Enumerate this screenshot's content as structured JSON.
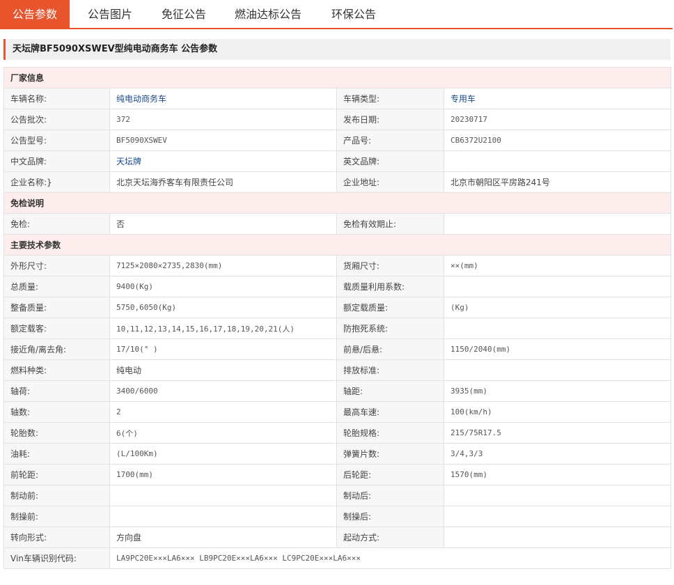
{
  "tabs": [
    "公告参数",
    "公告图片",
    "免征公告",
    "燃油达标公告",
    "环保公告"
  ],
  "title": "天坛牌BF5090XSWEV型纯电动商务车 公告参数",
  "sections": {
    "manufacturer": "厂家信息",
    "exemption": "免检说明",
    "tech": "主要技术参数"
  },
  "rows": {
    "r1": {
      "l1": "车辆名称:",
      "v1": "纯电动商务车",
      "l2": "车辆类型:",
      "v2": "专用车"
    },
    "r2": {
      "l1": "公告批次:",
      "v1": "372",
      "l2": "发布日期:",
      "v2": "20230717"
    },
    "r3": {
      "l1": "公告型号:",
      "v1": "BF5090XSWEV",
      "l2": "产品号:",
      "v2": "CB6372U2100"
    },
    "r4": {
      "l1": "中文品牌:",
      "v1": "天坛牌",
      "l2": "英文品牌:",
      "v2": ""
    },
    "r5": {
      "l1": "企业名称:}",
      "v1": "北京天坛海乔客车有限责任公司",
      "l2": "企业地址:",
      "v2": "北京市朝阳区平房路241号"
    },
    "r6": {
      "l1": "免检:",
      "v1": "否",
      "l2": "免检有效期止:",
      "v2": ""
    },
    "r7": {
      "l1": "外形尺寸:",
      "v1": "7125×2080×2735,2830(mm)",
      "l2": "货厢尺寸:",
      "v2": "××(mm)"
    },
    "r8": {
      "l1": "总质量:",
      "v1": "9400(Kg)",
      "l2": "载质量利用系数:",
      "v2": ""
    },
    "r9": {
      "l1": "整备质量:",
      "v1": "5750,6050(Kg)",
      "l2": "额定载质量:",
      "v2": "(Kg)"
    },
    "r10": {
      "l1": "额定载客:",
      "v1": "10,11,12,13,14,15,16,17,18,19,20,21(人)",
      "l2": "防抱死系统:",
      "v2": ""
    },
    "r11": {
      "l1": "接近角/离去角:",
      "v1": "17/10(° )",
      "l2": "前悬/后悬:",
      "v2": "1150/2040(mm)"
    },
    "r12": {
      "l1": "燃料种类:",
      "v1": "纯电动",
      "l2": "排放标准:",
      "v2": ""
    },
    "r13": {
      "l1": "轴荷:",
      "v1": "3400/6000",
      "l2": "轴距:",
      "v2": "3935(mm)"
    },
    "r14": {
      "l1": "轴数:",
      "v1": "2",
      "l2": "最高车速:",
      "v2": "100(km/h)"
    },
    "r15": {
      "l1": "轮胎数:",
      "v1": "6(个)",
      "l2": "轮胎规格:",
      "v2": "215/75R17.5"
    },
    "r16": {
      "l1": "油耗:",
      "v1": "(L/100Km)",
      "l2": "弹簧片数:",
      "v2": "3/4,3/3"
    },
    "r17": {
      "l1": "前轮距:",
      "v1": "1700(mm)",
      "l2": "后轮距:",
      "v2": "1570(mm)"
    },
    "r18": {
      "l1": "制动前:",
      "v1": "",
      "l2": "制动后:",
      "v2": ""
    },
    "r19": {
      "l1": "制操前:",
      "v1": "",
      "l2": "制操后:",
      "v2": ""
    },
    "r20": {
      "l1": "转向形式:",
      "v1": "方向盘",
      "l2": "起动方式:",
      "v2": ""
    },
    "r21": {
      "l1": "Vin车辆识别代码:",
      "v1": "LA9PC20E×××LA6××× LB9PC20E×××LA6××× LC9PC20E×××LA6×××"
    }
  }
}
